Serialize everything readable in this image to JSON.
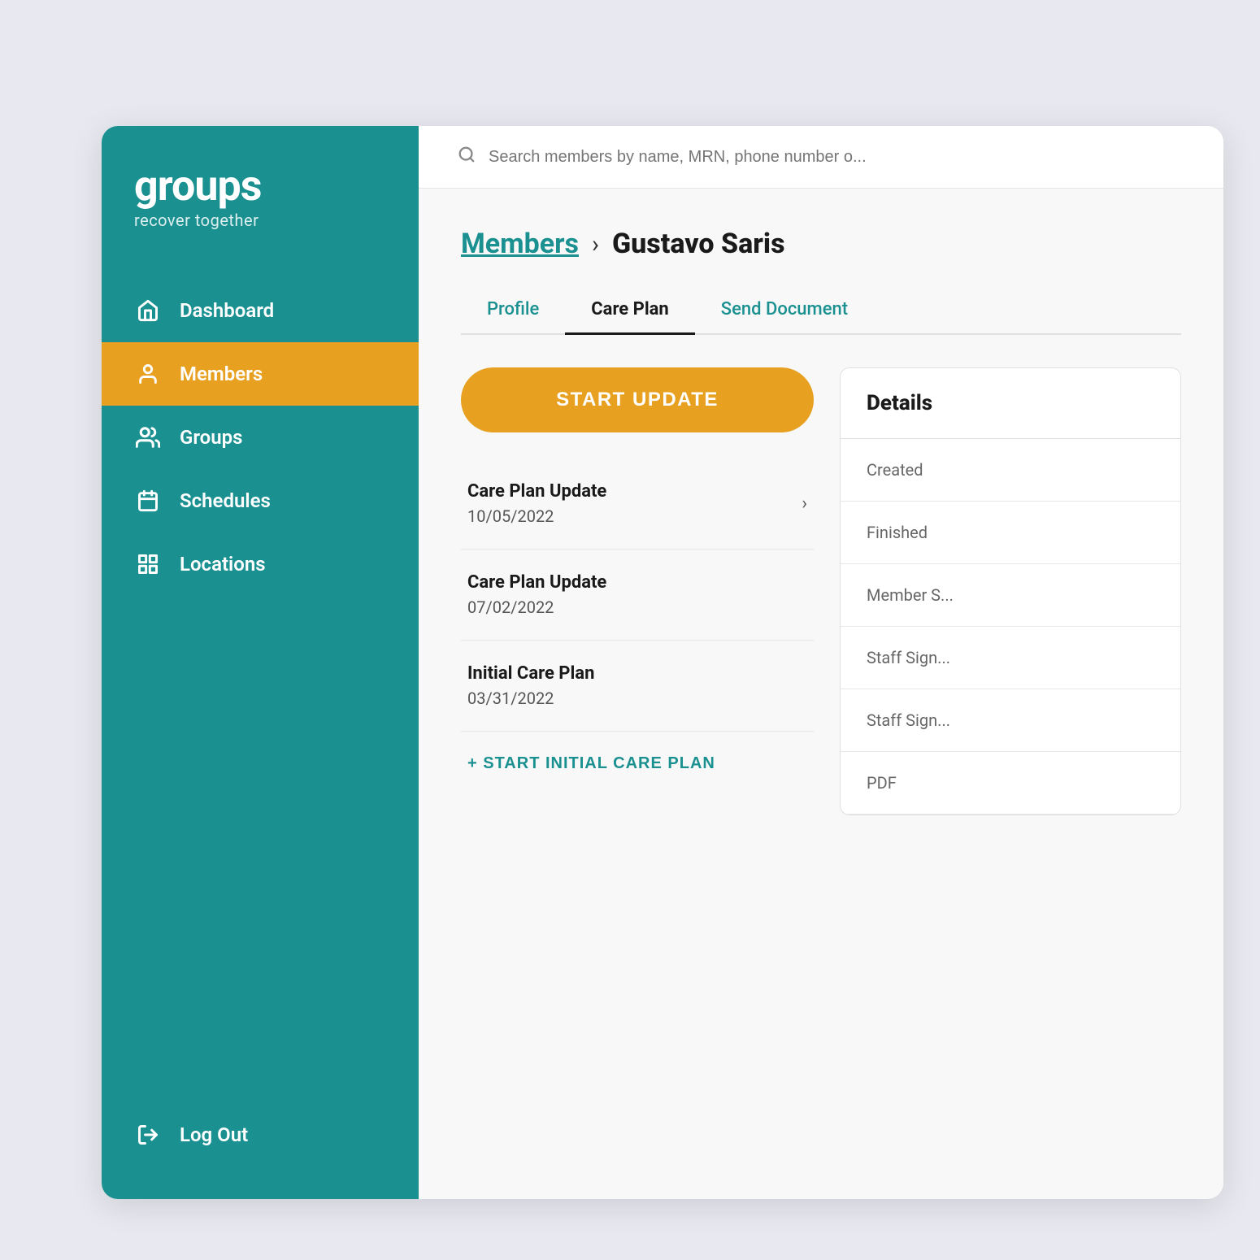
{
  "app": {
    "logo_text": "groups",
    "logo_tagline": "recover together"
  },
  "sidebar": {
    "items": [
      {
        "id": "dashboard",
        "label": "Dashboard",
        "icon": "home-icon",
        "active": false
      },
      {
        "id": "members",
        "label": "Members",
        "icon": "person-icon",
        "active": true
      },
      {
        "id": "groups",
        "label": "Groups",
        "icon": "group-icon",
        "active": false
      },
      {
        "id": "schedules",
        "label": "Schedules",
        "icon": "calendar-icon",
        "active": false
      },
      {
        "id": "locations",
        "label": "Locations",
        "icon": "building-icon",
        "active": false
      }
    ],
    "logout_label": "Log Out"
  },
  "search": {
    "placeholder": "Search members by name, MRN, phone number o..."
  },
  "breadcrumb": {
    "members_label": "Members",
    "member_name": "Gustavo Saris"
  },
  "tabs": [
    {
      "id": "profile",
      "label": "Profile",
      "active": false
    },
    {
      "id": "care-plan",
      "label": "Care Plan",
      "active": true
    },
    {
      "id": "send-document",
      "label": "Send Document",
      "active": false
    }
  ],
  "start_update_label": "START UPDATE",
  "care_plans": [
    {
      "title": "Care Plan Update",
      "date": "10/05/2022"
    },
    {
      "title": "Care Plan Update",
      "date": "07/02/2022"
    },
    {
      "title": "Initial Care Plan",
      "date": "03/31/2022"
    }
  ],
  "start_initial_label": "+ START INITIAL CARE PLAN",
  "details": {
    "title": "Details",
    "rows": [
      {
        "label": "Created",
        "value": ""
      },
      {
        "label": "Finished",
        "value": ""
      },
      {
        "label": "Member S...",
        "value": ""
      },
      {
        "label": "Staff Sign...",
        "value": ""
      },
      {
        "label": "Staff Sign...",
        "value": ""
      },
      {
        "label": "PDF",
        "value": ""
      }
    ]
  }
}
